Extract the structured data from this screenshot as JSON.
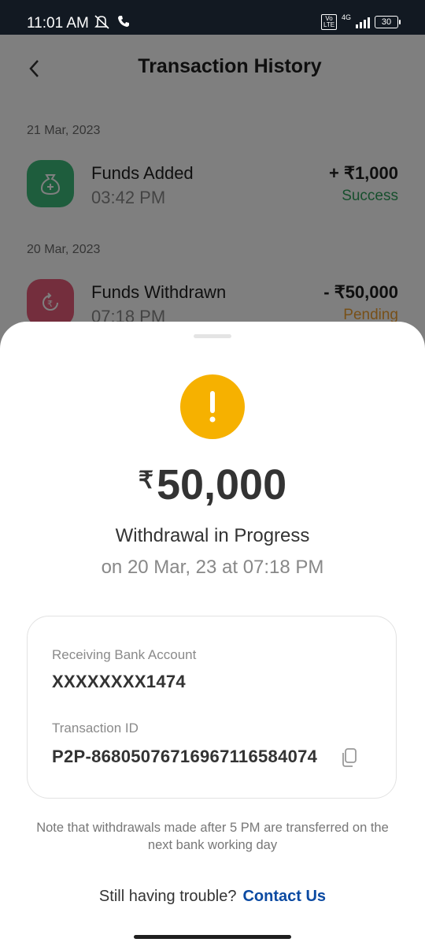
{
  "status_bar": {
    "time": "11:01 AM",
    "volte": "Vo LTE",
    "network": "4G",
    "battery": "30"
  },
  "header": {
    "title": "Transaction History"
  },
  "transactions": [
    {
      "date": "21 Mar, 2023",
      "title": "Funds Added",
      "time": "03:42 PM",
      "amount": "+ ₹1,000",
      "status": "Success",
      "status_color": "#2e9e5b",
      "icon_color": "#3dbb7a"
    },
    {
      "date": "20 Mar, 2023",
      "title": "Funds Withdrawn",
      "time": "07:18 PM",
      "amount": "- ₹50,000",
      "status": "Pending",
      "status_color": "#f0a030",
      "icon_color": "#e85c7a"
    }
  ],
  "sheet": {
    "currency": "₹",
    "amount": "50,000",
    "status": "Withdrawal in Progress",
    "date": "on 20 Mar, 23 at 07:18 PM",
    "bank_label": "Receiving Bank Account",
    "bank_value": "XXXXXXXX1474",
    "txn_label": "Transaction ID",
    "txn_value": "P2P-868050767169671165840 74",
    "note": "Note that withdrawals made after 5 PM are transferred on the next bank working day",
    "help_text": "Still having trouble?",
    "contact_label": "Contact Us"
  }
}
